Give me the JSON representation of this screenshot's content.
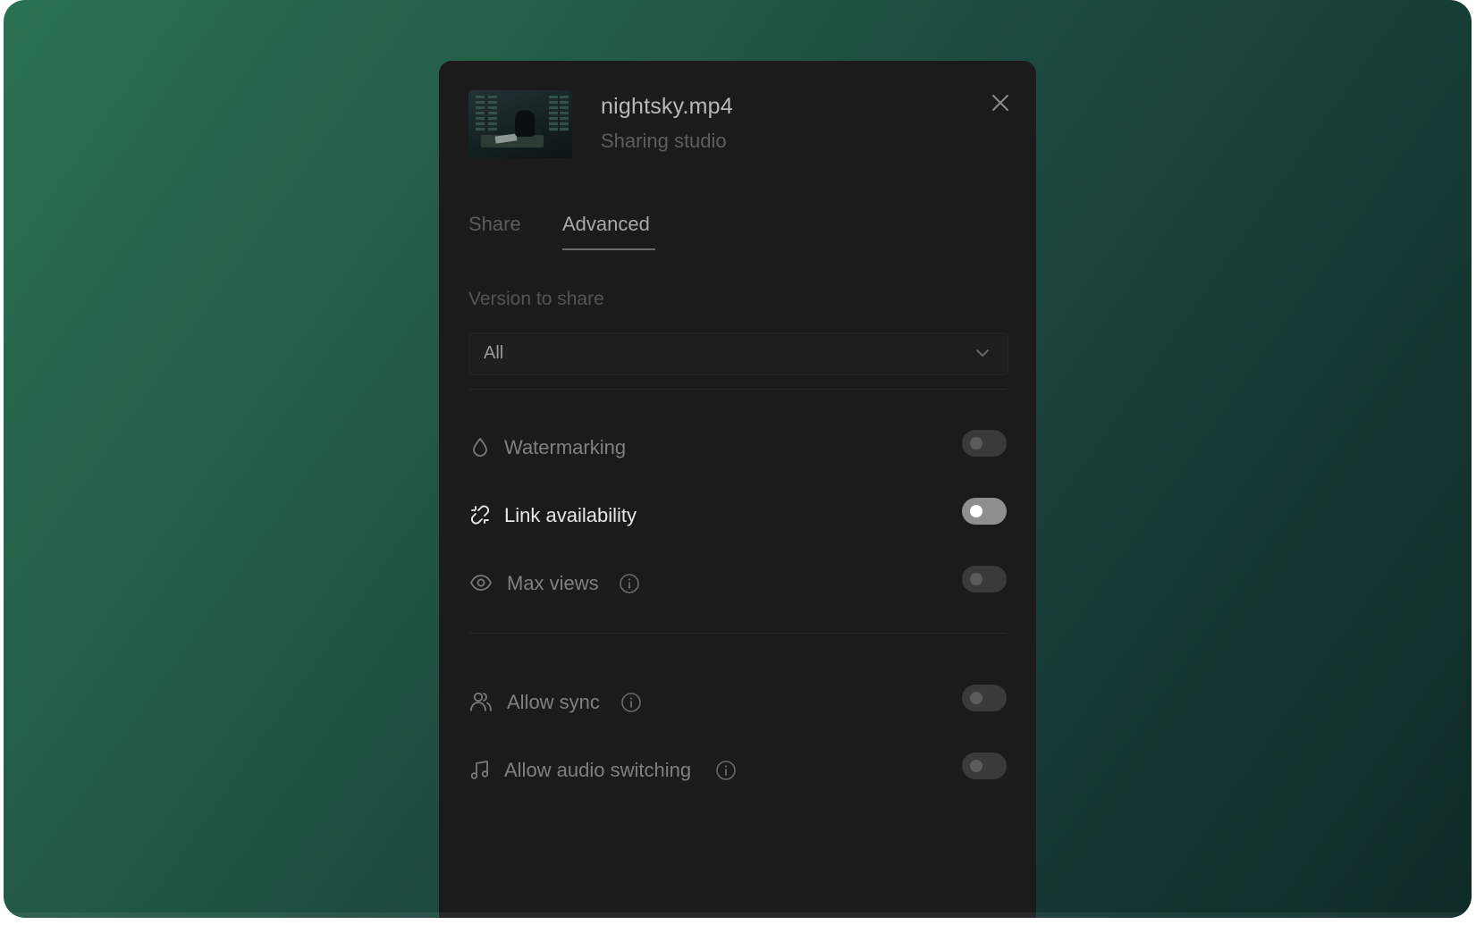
{
  "file": {
    "name": "nightsky.mp4",
    "subtitle": "Sharing studio"
  },
  "tabs": [
    {
      "label": "Share",
      "active": false
    },
    {
      "label": "Advanced",
      "active": true
    }
  ],
  "version": {
    "label": "Version to share",
    "selected": "All"
  },
  "settings": [
    {
      "label": "Watermarking",
      "icon": "droplet-icon",
      "on": false
    },
    {
      "label": "Link availability",
      "icon": "link-icon",
      "on": false,
      "highlighted": true
    },
    {
      "label": "Max views",
      "icon": "eye-icon",
      "on": false,
      "info": true
    },
    {
      "label": "Allow sync",
      "icon": "users-icon",
      "on": false,
      "info": true
    },
    {
      "label": "Allow audio switching",
      "icon": "music-note-icon",
      "on": false,
      "info": true
    }
  ],
  "colors": {
    "panel": "#1b1b1b",
    "accent_bg_start": "#2a7152",
    "accent_bg_end": "#0f2a28"
  }
}
